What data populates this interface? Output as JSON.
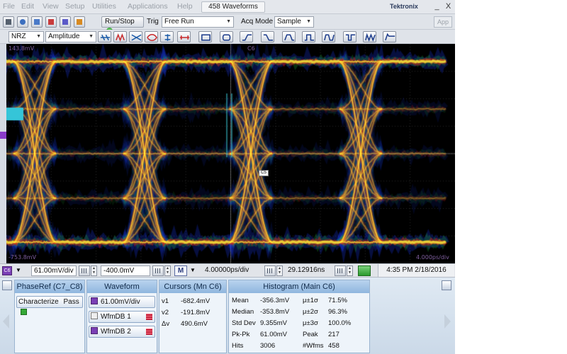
{
  "menubar": {
    "items": [
      "File",
      "Edit",
      "View",
      "Setup",
      "Utilities",
      "Applications",
      "Help"
    ],
    "title_tab": "458 Waveforms",
    "brand": "Tektronix",
    "minimize": "_",
    "close": "X"
  },
  "toolbar1": {
    "run_stop": "Run/Stop",
    "trig_label": "Trig",
    "trig_mode": "Free Run",
    "acq_mode_label": "Acq Mode",
    "acq_mode": "Sample",
    "app_button": "App"
  },
  "toolbar2": {
    "coding": "NRZ",
    "measurement": "Amplitude"
  },
  "scope": {
    "top_left": "143.8mV",
    "top_center": "C6",
    "bottom_left": "-753.8mV",
    "bottom_right": "4.000ps/div",
    "marker": "C5",
    "colors": {
      "hot": "#ffff40",
      "warm": "#ff2020",
      "cool": "#2050ff",
      "bg": "#000000"
    }
  },
  "control_strip": {
    "channel": "C6",
    "scale": "61.00mV/div",
    "offset": "-400.0mV",
    "mode": "M",
    "timebase": "4.00000ps/div",
    "position": "29.12916ns",
    "datetime": "4:35 PM 2/18/2016"
  },
  "phase_ref": {
    "title": "PhaseRef (C7_C8)",
    "action": "Characterize",
    "status": "Pass"
  },
  "waveform": {
    "title": "Waveform",
    "items": [
      "61.00mV/div",
      "WfmDB 1",
      "WfmDB 2"
    ]
  },
  "cursors": {
    "title": "Cursors (Mn C6)",
    "rows": [
      {
        "label": "v1",
        "value": "-682.4mV"
      },
      {
        "label": "v2",
        "value": "-191.8mV"
      },
      {
        "label": "Δv",
        "value": "490.6mV"
      }
    ]
  },
  "histogram": {
    "title": "Histogram (Main  C6)",
    "rows": [
      {
        "k1": "Mean",
        "v1": "-356.3mV",
        "k2": "μ±1σ",
        "v2": "71.5%"
      },
      {
        "k1": "Median",
        "v1": "-353.8mV",
        "k2": "μ±2σ",
        "v2": "96.3%"
      },
      {
        "k1": "Std Dev",
        "v1": "9.355mV",
        "k2": "μ±3σ",
        "v2": "100.0%"
      },
      {
        "k1": "Pk-Pk",
        "v1": "61.00mV",
        "k2": "Peak",
        "v2": "217"
      },
      {
        "k1": "Hits",
        "v1": "3006",
        "k2": "#Wfms",
        "v2": "458"
      }
    ]
  }
}
